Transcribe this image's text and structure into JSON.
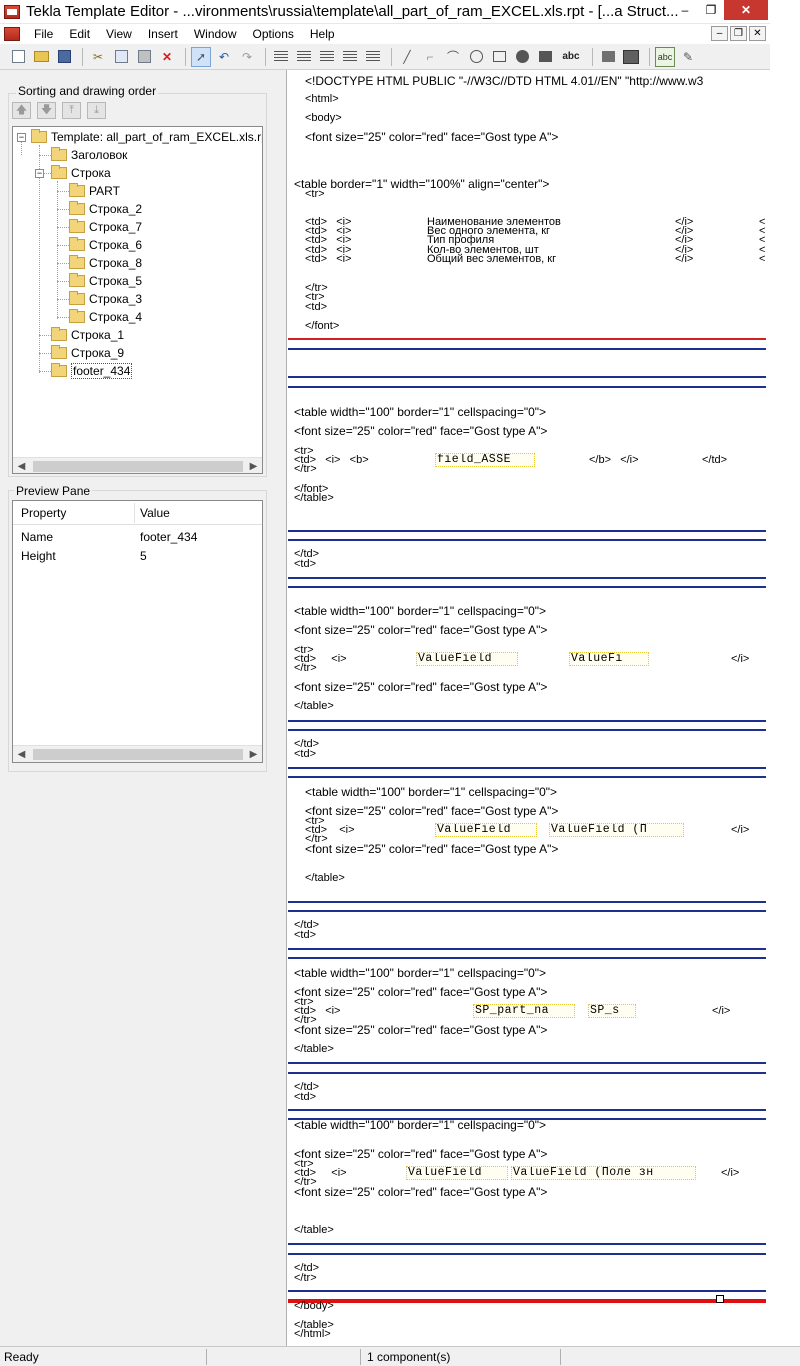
{
  "window": {
    "title": "Tekla Template Editor - ...vironments\\russia\\template\\all_part_of_ram_EXCEL.xls.rpt  - [...a Struct...",
    "minimize": "–",
    "maximize": "❐",
    "close": "✕"
  },
  "menu": {
    "items": [
      "File",
      "Edit",
      "View",
      "Insert",
      "Window",
      "Options",
      "Help"
    ],
    "mdi_buttons": [
      "–",
      "❐",
      "✕"
    ]
  },
  "toolbar": {
    "text_label": "abc",
    "field_label": "abc"
  },
  "sorting": {
    "label": "Sorting and drawing order",
    "buttons": [
      "🡅",
      "🡇",
      "⤒",
      "⤓"
    ]
  },
  "tree": {
    "nodes": [
      "Template: all_part_of_ram_EXCEL.xls.rpt",
      "Заголовок",
      "Строка",
      "PART",
      "Строка_2",
      "Строка_7",
      "Строка_6",
      "Строка_8",
      "Строка_5",
      "Строка_3",
      "Строка_4",
      "Строка_1",
      "Строка_9",
      "footer_434"
    ],
    "selected": "footer_434"
  },
  "preview": {
    "label": "Preview Pane",
    "columns": [
      "Property",
      "Value"
    ],
    "rows": [
      {
        "property": "Name",
        "value": "footer_434"
      },
      {
        "property": "Height",
        "value": "5"
      }
    ]
  },
  "editor": {
    "lines": [
      "<!DOCTYPE HTML PUBLIC \"-//W3C//DTD HTML 4.01//EN\" \"http://www.w3",
      "<html>",
      "<body>",
      "<font size=\"25\" color=\"red\" face=\"Gost type A\">",
      "<table border=\"1\" width=\"100%\" align=\"center\">",
      "<tr>",
      "<td>   <i>",
      "<td>   <i>",
      "<td>   <i>",
      "<td>   <i>",
      "<td>   <i>",
      "Наименование элементов",
      "Вес одного элемента, кг",
      "Тип профиля",
      "Кол-во элементов, шт",
      "Общий вес элементов, кг",
      "</i>",
      "</tr>",
      "<tr>",
      "<td>",
      "</font>",
      "<table width=\"100\" border=\"1\" cellspacing=\"0\">",
      "<font size=\"25\" color=\"red\" face=\"Gost type A\">",
      "<tr>",
      "<td>   <i>   <b>",
      "</b>   </i>",
      "</td>",
      "</tr>",
      "</font>",
      "</table>",
      "</td>",
      "<td>",
      "<td>     <i>",
      "</i>",
      "<td>    <i>",
      "</i>",
      "<td>   <i>",
      "</i>",
      "<td>     <i>",
      "</i>",
      "</body>",
      "</table>",
      "</html>",
      "<"
    ],
    "fields": [
      "field_ASSE",
      "ValueField",
      "ValueFi",
      "ValueField",
      "ValueField (П",
      "SP_part_na",
      "SP_s",
      "ValueField",
      "ValueField (Поле зн"
    ]
  },
  "status": {
    "left": "Ready",
    "components": "1 component(s)"
  },
  "colors": {
    "separator_blue": "#1d2f8f",
    "separator_red": "#d02020",
    "close_red": "#c7372f",
    "field_border": "#e8c830"
  }
}
